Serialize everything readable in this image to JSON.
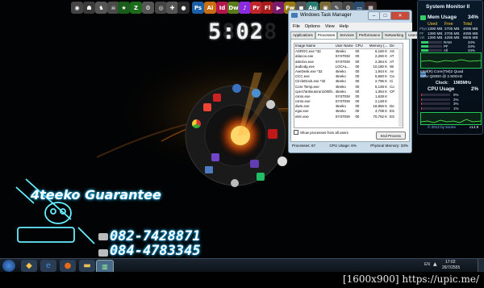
{
  "dock": {
    "icons": [
      {
        "name": "robot-icon",
        "glyph": "◉",
        "color": "#444"
      },
      {
        "name": "mask-icon",
        "glyph": "☗",
        "color": "#3a3a3a"
      },
      {
        "name": "warrior-icon",
        "glyph": "♞",
        "color": "#555"
      },
      {
        "name": "skull-icon",
        "glyph": "☠",
        "color": "#4a4a4a"
      },
      {
        "name": "star-icon",
        "glyph": "★",
        "color": "#1a5c1a"
      },
      {
        "name": "zone-icon",
        "glyph": "Z",
        "color": "#1c6b1c"
      },
      {
        "name": "gear-icon",
        "glyph": "⚙",
        "color": "#555"
      },
      {
        "name": "target-icon",
        "glyph": "◎",
        "color": "#444"
      },
      {
        "name": "compass-icon",
        "glyph": "✚",
        "color": "#555"
      },
      {
        "name": "circle-icon",
        "glyph": "●",
        "color": "#2a2a2a"
      },
      {
        "name": "photoshop-icon",
        "glyph": "Ps",
        "color": "#1b5fa6"
      },
      {
        "name": "illustrator-icon",
        "glyph": "Ai",
        "color": "#c86d11"
      },
      {
        "name": "indesign-icon",
        "glyph": "Id",
        "color": "#b4154b"
      },
      {
        "name": "dreamweaver-icon",
        "glyph": "Dw",
        "color": "#5a7d19"
      },
      {
        "name": "premiere-icon",
        "glyph": "♪",
        "color": "#8a2be2"
      },
      {
        "name": "pdf-icon",
        "glyph": "Pr",
        "color": "#c0262e"
      },
      {
        "name": "flash-icon",
        "glyph": "Fl",
        "color": "#a51c1c"
      },
      {
        "name": "media-icon",
        "glyph": "▶",
        "color": "#7a1a6a"
      },
      {
        "name": "fireworks-icon",
        "glyph": "Fw",
        "color": "#9a7a10"
      },
      {
        "name": "player-icon",
        "glyph": "◼",
        "color": "#555"
      },
      {
        "name": "audition-icon",
        "glyph": "Au",
        "color": "#2a7c72"
      },
      {
        "name": "folder-icon",
        "glyph": "▣",
        "color": "#7a6a3a"
      },
      {
        "name": "pencil-icon",
        "glyph": "✎",
        "color": "#5a5a5a"
      },
      {
        "name": "settings-icon",
        "glyph": "⚙",
        "color": "#444"
      },
      {
        "name": "monitor-icon",
        "glyph": "▭",
        "color": "#2a4a6a"
      },
      {
        "name": "film-icon",
        "glyph": "▦",
        "color": "#3a2a2a"
      }
    ]
  },
  "clock": {
    "time": "5:02",
    "ghost": "88:88"
  },
  "taskmgr": {
    "title": "Windows Task Manager",
    "menu": [
      "File",
      "Options",
      "View",
      "Help"
    ],
    "tabs": [
      "Applications",
      "Processes",
      "Services",
      "Performance",
      "Networking",
      "Users"
    ],
    "active_tab": "Processes",
    "columns": [
      "Image Name",
      "User Name",
      "CPU",
      "Memory (...",
      "De"
    ],
    "rows": [
      [
        "ASROC.exe *32",
        "4teeko",
        "00",
        "6,160 K",
        "AS"
      ],
      [
        "atiacoo.exe",
        "SYSTEM",
        "00",
        "2,260 K",
        "AT"
      ],
      [
        "atieclxx.exe",
        "SYSTEM",
        "00",
        "2,364 K",
        "AT"
      ],
      [
        "audiodg.exe",
        "LOCAL...",
        "00",
        "10,180 K",
        "Wi"
      ],
      [
        "AveDesk.exe *32",
        "4teeko",
        "00",
        "1,944 K",
        "Av"
      ],
      [
        "CCC.exe",
        "4teeko",
        "00",
        "5,660 K",
        "Ca"
      ],
      [
        "CircleDock.exe *32",
        "4teeko",
        "00",
        "2,796 K",
        "Ci"
      ],
      [
        "Core Temp.exe",
        "4teeko",
        "00",
        "5,148 K",
        "Co"
      ],
      [
        "cpe17antisutorun1000h...",
        "4teeko",
        "00",
        "1,364 K",
        "CP"
      ],
      [
        "csrss.exe",
        "SYSTEM",
        "00",
        "1,628 K",
        ""
      ],
      [
        "csrss.exe",
        "SYSTEM",
        "00",
        "2,148 K",
        ""
      ],
      [
        "dwm.exe",
        "4teeko",
        "00",
        "18,856 K",
        "De"
      ],
      [
        "egui.exe",
        "4teeko",
        "00",
        "4,708 K",
        "ES"
      ],
      [
        "ekrn.exe",
        "SYSTEM",
        "00",
        "70,752 K",
        "ES"
      ]
    ],
    "show_all_label": "Show processes from all users",
    "end_process_label": "End Process",
    "status": {
      "processes": "Processes: 67",
      "cpu": "CPU Usage: 6%",
      "memory": "Physical Memory: 33%"
    }
  },
  "sysmon": {
    "title": "System Monitor II",
    "mem_label": "Mem Usage",
    "mem_value": "34%",
    "mem_head": [
      "Used",
      "Free",
      "Total"
    ],
    "mem_rows": [
      [
        "1390 MB",
        "2705 MB",
        "4095 MB"
      ],
      [
        "1390 MB",
        "2705 MB",
        "4095 MB"
      ],
      [
        "1390 MB",
        "4286 MB",
        "8605 MB"
      ]
    ],
    "mem_row_labels": [
      "Phys",
      "PF",
      "Virt"
    ],
    "bar_labels": [
      "RAM",
      "PF",
      "All"
    ],
    "bar_values": [
      "34%",
      "34%",
      "34%"
    ],
    "cpu_name": "Intel(R) Core(TM)2 Quad",
    "cpu_model": "CPU    Q8300  @ 2.50GHz",
    "clock_label": "Clock:",
    "clock_value": "1985MHz",
    "cpu_usage_label": "CPU Usage",
    "cpu_usage_value": "2%",
    "core_values": [
      "0%",
      "2%",
      "3%",
      "1%"
    ],
    "footer": "© 2012 by 5ones",
    "version": "v14.9"
  },
  "banner": {
    "brand": "4teeko Guarantee",
    "phone1": "082-7428871",
    "phone2": "084-4783345"
  },
  "taskbar": {
    "lang": "EN",
    "time": "17:02",
    "date": "26/7/2555"
  },
  "watermark": {
    "text": "[1600x900] https://upic.me/"
  }
}
